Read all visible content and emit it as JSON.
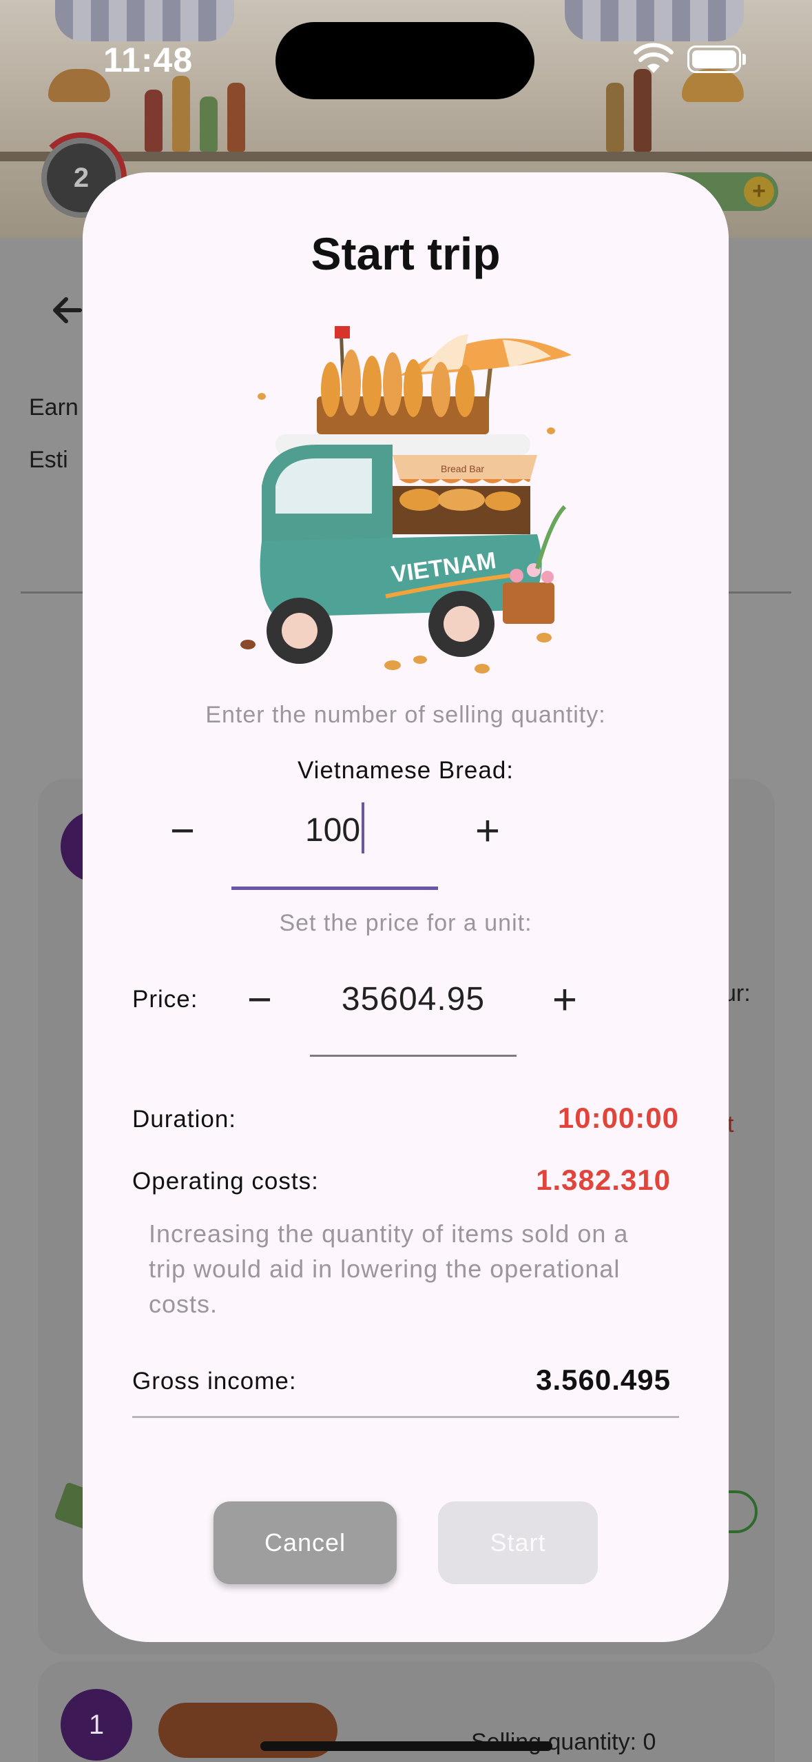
{
  "status_bar": {
    "time": "11:48"
  },
  "background": {
    "level": "2",
    "earnings_label_partial": "Earn",
    "estimate_label_partial": "Esti",
    "card_partial_text": "ur:",
    "card_red_partial": "t",
    "bottom_card_badge": "1",
    "bottom_card_text": "Selling quantity: 0",
    "coin_symbol": "+"
  },
  "dialog": {
    "title": "Start trip",
    "quantity_hint": "Enter the number of selling quantity:",
    "product_label": "Vietnamese Bread:",
    "quantity_value": "100",
    "price_hint": "Set the price for a unit:",
    "price_label": "Price:",
    "price_value": "35604.95",
    "duration_label": "Duration:",
    "duration_value": "10:00:00",
    "operating_costs_label": "Operating costs:",
    "operating_costs_value": "1.382.310",
    "note": "Increasing the quantity of items sold on a trip would aid in lowering the operational costs.",
    "gross_income_label": "Gross income:",
    "gross_income_value": "3.560.495",
    "cancel_label": "Cancel",
    "start_label": "Start",
    "minus_symbol": "−",
    "plus_symbol": "+",
    "cart_sign_text": "VIETNAM",
    "awning_sign_text": "Bread Bar"
  },
  "colors": {
    "accent": "#6a55a8",
    "warning_red": "#e0443a",
    "dialog_bg": "#fdf7fd",
    "cancel_bg": "#9e9e9e",
    "start_disabled_bg": "#e4e1e6"
  }
}
